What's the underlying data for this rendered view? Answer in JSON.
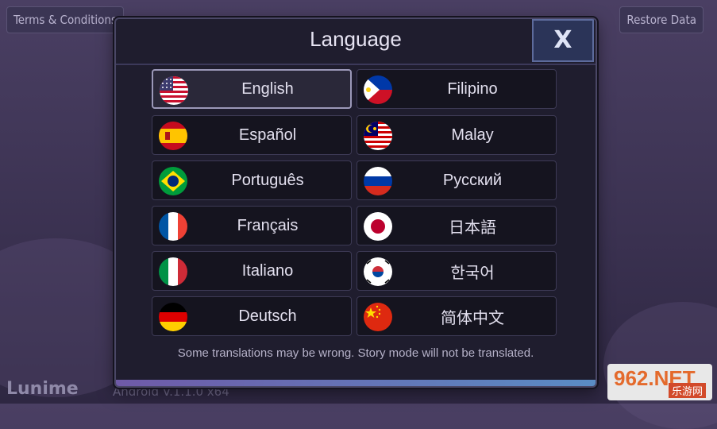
{
  "top_bar": {
    "terms_label": "Terms & Conditions",
    "restore_label": "Restore Data"
  },
  "dialog": {
    "title": "Language",
    "close_label": "X",
    "note": "Some translations may be wrong. Story mode will not be translated.",
    "selected": "English",
    "languages": [
      {
        "label": "English",
        "flag": "us-flag-icon"
      },
      {
        "label": "Filipino",
        "flag": "philippines-flag-icon"
      },
      {
        "label": "Español",
        "flag": "spain-flag-icon"
      },
      {
        "label": "Malay",
        "flag": "malaysia-flag-icon"
      },
      {
        "label": "Português",
        "flag": "brazil-flag-icon"
      },
      {
        "label": "Русский",
        "flag": "russia-flag-icon"
      },
      {
        "label": "Français",
        "flag": "france-flag-icon"
      },
      {
        "label": "日本語",
        "flag": "japan-flag-icon"
      },
      {
        "label": "Italiano",
        "flag": "italy-flag-icon"
      },
      {
        "label": "한국어",
        "flag": "korea-flag-icon"
      },
      {
        "label": "Deutsch",
        "flag": "germany-flag-icon"
      },
      {
        "label": "简体中文",
        "flag": "china-flag-icon"
      }
    ]
  },
  "footer": {
    "brand": "Lunime",
    "version": "Android V.1.1.0 x64"
  },
  "watermark": {
    "big": "962.NET",
    "small": "乐游网"
  },
  "colors": {
    "dialog_bg": "#1f1d2e",
    "button_bg": "#15141f",
    "selected_border": "#9b98b8"
  }
}
